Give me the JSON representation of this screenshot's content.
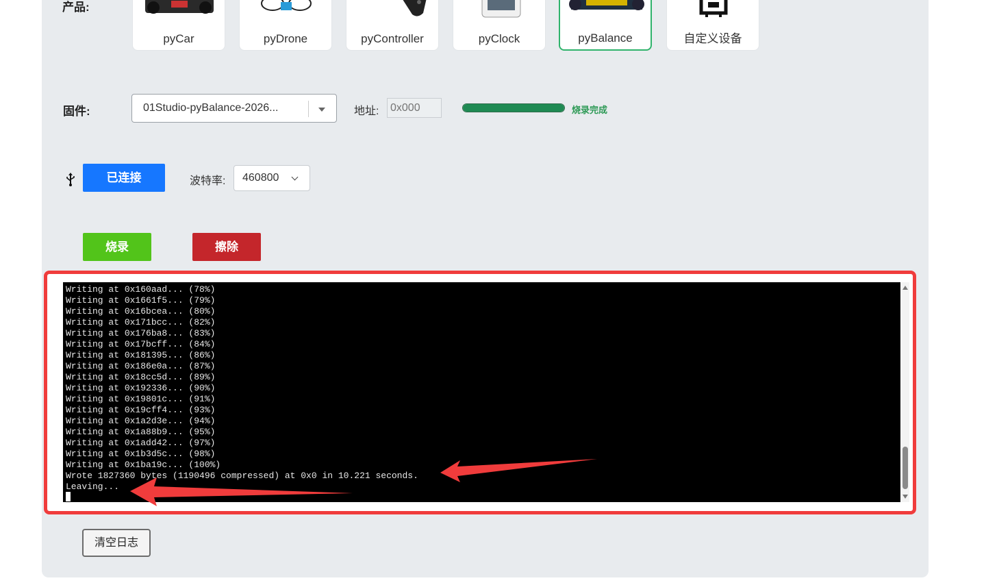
{
  "product": {
    "label": "产品:",
    "items": [
      {
        "name": "pyCar",
        "active": false
      },
      {
        "name": "pyDrone",
        "active": false
      },
      {
        "name": "pyController",
        "active": false
      },
      {
        "name": "pyClock",
        "active": false
      },
      {
        "name": "pyBalance",
        "active": true
      },
      {
        "name": "自定义设备",
        "active": false
      }
    ]
  },
  "firmware": {
    "label": "固件:",
    "selected": "01Studio-pyBalance-2026...",
    "address_label": "地址:",
    "address_placeholder": "0x000",
    "progress": 1.0,
    "progress_text": "烧录完成"
  },
  "connection": {
    "usb_icon": "usb-icon",
    "connect_label": "已连接",
    "baud_label": "波特率:",
    "baud_value": "460800"
  },
  "actions": {
    "flash_label": "烧录",
    "erase_label": "擦除"
  },
  "colors": {
    "connect": "#1677ff",
    "flash": "#52c41a",
    "erase": "#c4262b",
    "highlight": "#f03c3c",
    "progress": "#1f8a53",
    "active_card": "#2fb36b"
  },
  "console": {
    "lines": [
      "Writing at 0x160aad... (78%)",
      "Writing at 0x1661f5... (79%)",
      "Writing at 0x16bcea... (80%)",
      "Writing at 0x171bcc... (82%)",
      "Writing at 0x176ba8... (83%)",
      "Writing at 0x17bcff... (84%)",
      "Writing at 0x181395... (86%)",
      "Writing at 0x186e0a... (87%)",
      "Writing at 0x18cc5d... (89%)",
      "Writing at 0x192336... (90%)",
      "Writing at 0x19801c... (91%)",
      "Writing at 0x19cff4... (93%)",
      "Writing at 0x1a2d3e... (94%)",
      "Writing at 0x1a88b9... (95%)",
      "Writing at 0x1add42... (97%)",
      "Writing at 0x1b3d5c... (98%)",
      "Writing at 0x1ba19c... (100%)",
      "Wrote 1827360 bytes (1190496 compressed) at 0x0 in 10.221 seconds.",
      "Leaving..."
    ]
  },
  "clear_log_label": "清空日志"
}
